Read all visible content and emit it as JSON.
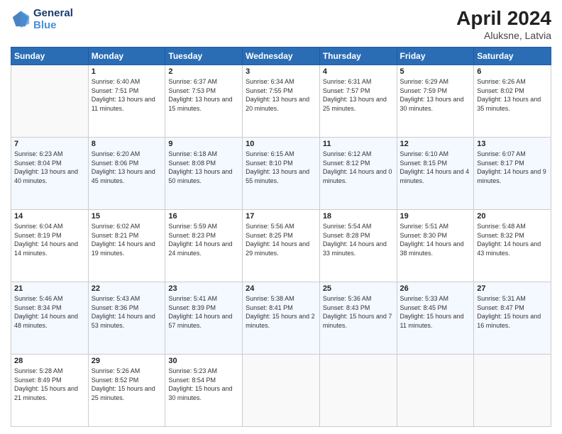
{
  "header": {
    "logo_line1": "General",
    "logo_line2": "Blue",
    "month_year": "April 2024",
    "location": "Aluksne, Latvia"
  },
  "days_of_week": [
    "Sunday",
    "Monday",
    "Tuesday",
    "Wednesday",
    "Thursday",
    "Friday",
    "Saturday"
  ],
  "weeks": [
    [
      {
        "day": "",
        "sunrise": "",
        "sunset": "",
        "daylight": ""
      },
      {
        "day": "1",
        "sunrise": "Sunrise: 6:40 AM",
        "sunset": "Sunset: 7:51 PM",
        "daylight": "Daylight: 13 hours and 11 minutes."
      },
      {
        "day": "2",
        "sunrise": "Sunrise: 6:37 AM",
        "sunset": "Sunset: 7:53 PM",
        "daylight": "Daylight: 13 hours and 15 minutes."
      },
      {
        "day": "3",
        "sunrise": "Sunrise: 6:34 AM",
        "sunset": "Sunset: 7:55 PM",
        "daylight": "Daylight: 13 hours and 20 minutes."
      },
      {
        "day": "4",
        "sunrise": "Sunrise: 6:31 AM",
        "sunset": "Sunset: 7:57 PM",
        "daylight": "Daylight: 13 hours and 25 minutes."
      },
      {
        "day": "5",
        "sunrise": "Sunrise: 6:29 AM",
        "sunset": "Sunset: 7:59 PM",
        "daylight": "Daylight: 13 hours and 30 minutes."
      },
      {
        "day": "6",
        "sunrise": "Sunrise: 6:26 AM",
        "sunset": "Sunset: 8:02 PM",
        "daylight": "Daylight: 13 hours and 35 minutes."
      }
    ],
    [
      {
        "day": "7",
        "sunrise": "Sunrise: 6:23 AM",
        "sunset": "Sunset: 8:04 PM",
        "daylight": "Daylight: 13 hours and 40 minutes."
      },
      {
        "day": "8",
        "sunrise": "Sunrise: 6:20 AM",
        "sunset": "Sunset: 8:06 PM",
        "daylight": "Daylight: 13 hours and 45 minutes."
      },
      {
        "day": "9",
        "sunrise": "Sunrise: 6:18 AM",
        "sunset": "Sunset: 8:08 PM",
        "daylight": "Daylight: 13 hours and 50 minutes."
      },
      {
        "day": "10",
        "sunrise": "Sunrise: 6:15 AM",
        "sunset": "Sunset: 8:10 PM",
        "daylight": "Daylight: 13 hours and 55 minutes."
      },
      {
        "day": "11",
        "sunrise": "Sunrise: 6:12 AM",
        "sunset": "Sunset: 8:12 PM",
        "daylight": "Daylight: 14 hours and 0 minutes."
      },
      {
        "day": "12",
        "sunrise": "Sunrise: 6:10 AM",
        "sunset": "Sunset: 8:15 PM",
        "daylight": "Daylight: 14 hours and 4 minutes."
      },
      {
        "day": "13",
        "sunrise": "Sunrise: 6:07 AM",
        "sunset": "Sunset: 8:17 PM",
        "daylight": "Daylight: 14 hours and 9 minutes."
      }
    ],
    [
      {
        "day": "14",
        "sunrise": "Sunrise: 6:04 AM",
        "sunset": "Sunset: 8:19 PM",
        "daylight": "Daylight: 14 hours and 14 minutes."
      },
      {
        "day": "15",
        "sunrise": "Sunrise: 6:02 AM",
        "sunset": "Sunset: 8:21 PM",
        "daylight": "Daylight: 14 hours and 19 minutes."
      },
      {
        "day": "16",
        "sunrise": "Sunrise: 5:59 AM",
        "sunset": "Sunset: 8:23 PM",
        "daylight": "Daylight: 14 hours and 24 minutes."
      },
      {
        "day": "17",
        "sunrise": "Sunrise: 5:56 AM",
        "sunset": "Sunset: 8:25 PM",
        "daylight": "Daylight: 14 hours and 29 minutes."
      },
      {
        "day": "18",
        "sunrise": "Sunrise: 5:54 AM",
        "sunset": "Sunset: 8:28 PM",
        "daylight": "Daylight: 14 hours and 33 minutes."
      },
      {
        "day": "19",
        "sunrise": "Sunrise: 5:51 AM",
        "sunset": "Sunset: 8:30 PM",
        "daylight": "Daylight: 14 hours and 38 minutes."
      },
      {
        "day": "20",
        "sunrise": "Sunrise: 5:48 AM",
        "sunset": "Sunset: 8:32 PM",
        "daylight": "Daylight: 14 hours and 43 minutes."
      }
    ],
    [
      {
        "day": "21",
        "sunrise": "Sunrise: 5:46 AM",
        "sunset": "Sunset: 8:34 PM",
        "daylight": "Daylight: 14 hours and 48 minutes."
      },
      {
        "day": "22",
        "sunrise": "Sunrise: 5:43 AM",
        "sunset": "Sunset: 8:36 PM",
        "daylight": "Daylight: 14 hours and 53 minutes."
      },
      {
        "day": "23",
        "sunrise": "Sunrise: 5:41 AM",
        "sunset": "Sunset: 8:39 PM",
        "daylight": "Daylight: 14 hours and 57 minutes."
      },
      {
        "day": "24",
        "sunrise": "Sunrise: 5:38 AM",
        "sunset": "Sunset: 8:41 PM",
        "daylight": "Daylight: 15 hours and 2 minutes."
      },
      {
        "day": "25",
        "sunrise": "Sunrise: 5:36 AM",
        "sunset": "Sunset: 8:43 PM",
        "daylight": "Daylight: 15 hours and 7 minutes."
      },
      {
        "day": "26",
        "sunrise": "Sunrise: 5:33 AM",
        "sunset": "Sunset: 8:45 PM",
        "daylight": "Daylight: 15 hours and 11 minutes."
      },
      {
        "day": "27",
        "sunrise": "Sunrise: 5:31 AM",
        "sunset": "Sunset: 8:47 PM",
        "daylight": "Daylight: 15 hours and 16 minutes."
      }
    ],
    [
      {
        "day": "28",
        "sunrise": "Sunrise: 5:28 AM",
        "sunset": "Sunset: 8:49 PM",
        "daylight": "Daylight: 15 hours and 21 minutes."
      },
      {
        "day": "29",
        "sunrise": "Sunrise: 5:26 AM",
        "sunset": "Sunset: 8:52 PM",
        "daylight": "Daylight: 15 hours and 25 minutes."
      },
      {
        "day": "30",
        "sunrise": "Sunrise: 5:23 AM",
        "sunset": "Sunset: 8:54 PM",
        "daylight": "Daylight: 15 hours and 30 minutes."
      },
      {
        "day": "",
        "sunrise": "",
        "sunset": "",
        "daylight": ""
      },
      {
        "day": "",
        "sunrise": "",
        "sunset": "",
        "daylight": ""
      },
      {
        "day": "",
        "sunrise": "",
        "sunset": "",
        "daylight": ""
      },
      {
        "day": "",
        "sunrise": "",
        "sunset": "",
        "daylight": ""
      }
    ]
  ]
}
